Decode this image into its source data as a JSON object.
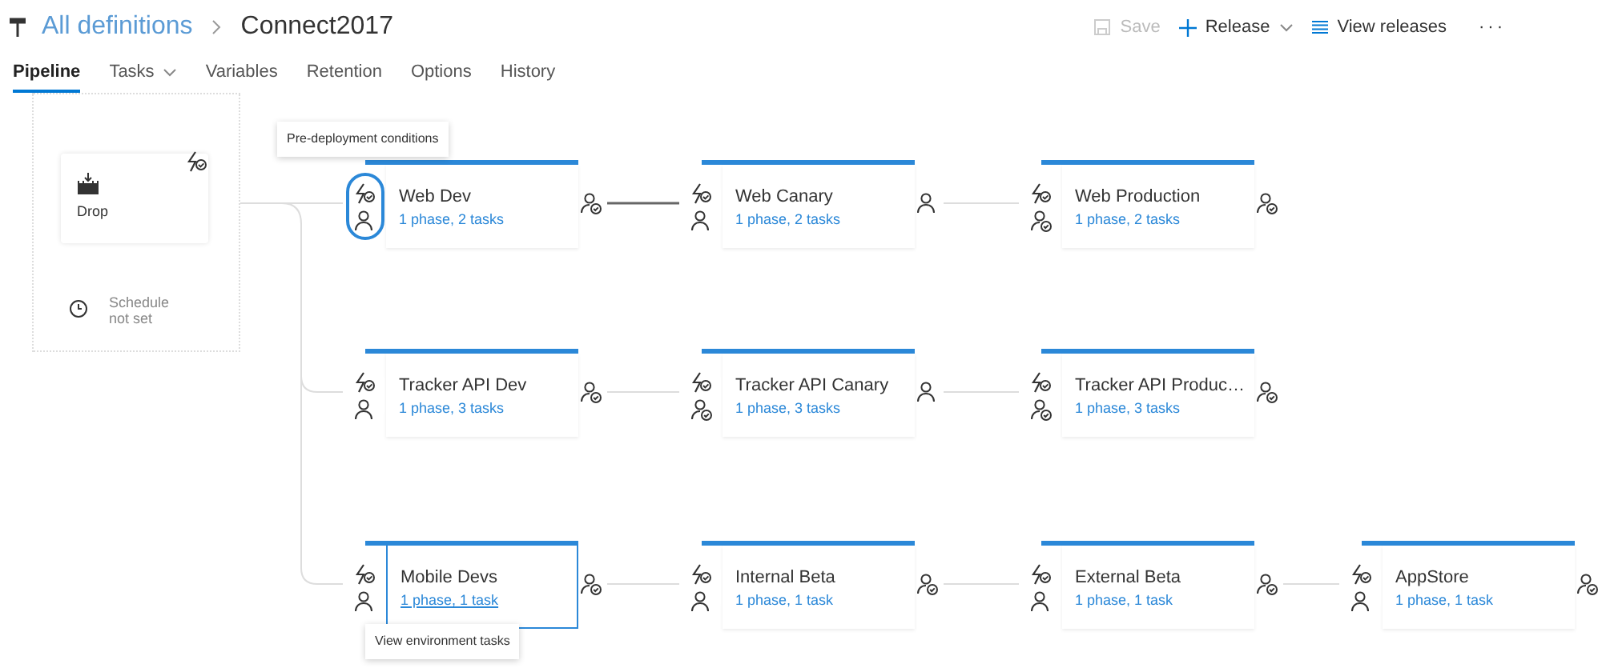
{
  "header": {
    "breadcrumb_link": "All definitions",
    "title": "Connect2017"
  },
  "toolbar": [
    {
      "kind": "save",
      "label": "Save",
      "disabled": true,
      "dropdown": false
    },
    {
      "kind": "add",
      "label": "Release",
      "disabled": false,
      "dropdown": true
    },
    {
      "kind": "list",
      "label": "View releases",
      "disabled": false,
      "dropdown": false
    },
    {
      "kind": "more",
      "label": "···",
      "disabled": false,
      "dropdown": false
    }
  ],
  "tabs": [
    {
      "label": "Pipeline",
      "selected": true,
      "dropdown": false
    },
    {
      "label": "Tasks",
      "selected": false,
      "dropdown": true
    },
    {
      "label": "Variables",
      "selected": false,
      "dropdown": false
    },
    {
      "label": "Retention",
      "selected": false,
      "dropdown": false
    },
    {
      "label": "Options",
      "selected": false,
      "dropdown": false
    },
    {
      "label": "History",
      "selected": false,
      "dropdown": false
    }
  ],
  "artifacts": {
    "items": [
      {
        "label": "Drop",
        "kind": "build"
      }
    ],
    "schedule": "Schedule not set"
  },
  "environments": [
    [
      {
        "name": "Web Dev",
        "summary": "1 phase, 2 tasks",
        "pre_approvers": false,
        "post_approvers": true,
        "focused": true,
        "selected": false,
        "link_hovered": false,
        "tooltip": "Pre-deployment conditions"
      },
      {
        "name": "Web Canary",
        "summary": "1 phase, 2 tasks",
        "pre_approvers": false,
        "post_approvers": false,
        "focused": false,
        "selected": false,
        "link_hovered": false
      },
      {
        "name": "Web Production",
        "summary": "1 phase, 2 tasks",
        "pre_approvers": true,
        "post_approvers": true,
        "focused": false,
        "selected": false,
        "link_hovered": false
      }
    ],
    [
      {
        "name": "Tracker API Dev",
        "summary": "1 phase, 3 tasks",
        "pre_approvers": false,
        "post_approvers": true,
        "focused": false,
        "selected": false,
        "link_hovered": false
      },
      {
        "name": "Tracker API Canary",
        "summary": "1 phase, 3 tasks",
        "pre_approvers": true,
        "post_approvers": false,
        "focused": false,
        "selected": false,
        "link_hovered": false
      },
      {
        "name": "Tracker API Produc…",
        "summary": "1 phase, 3 tasks",
        "pre_approvers": true,
        "post_approvers": true,
        "focused": false,
        "selected": false,
        "link_hovered": false
      }
    ],
    [
      {
        "name": "Mobile Devs",
        "summary": "1 phase, 1 task",
        "pre_approvers": false,
        "post_approvers": true,
        "focused": false,
        "selected": true,
        "link_hovered": true,
        "tooltip": "View environment tasks"
      },
      {
        "name": "Internal Beta",
        "summary": "1 phase, 1 task",
        "pre_approvers": false,
        "post_approvers": true,
        "focused": false,
        "selected": false,
        "link_hovered": false
      },
      {
        "name": "External Beta",
        "summary": "1 phase, 1 task",
        "pre_approvers": false,
        "post_approvers": true,
        "focused": false,
        "selected": false,
        "link_hovered": false
      },
      {
        "name": "AppStore",
        "summary": "1 phase, 1 task",
        "pre_approvers": false,
        "post_approvers": true,
        "focused": false,
        "selected": false,
        "link_hovered": false
      }
    ]
  ]
}
